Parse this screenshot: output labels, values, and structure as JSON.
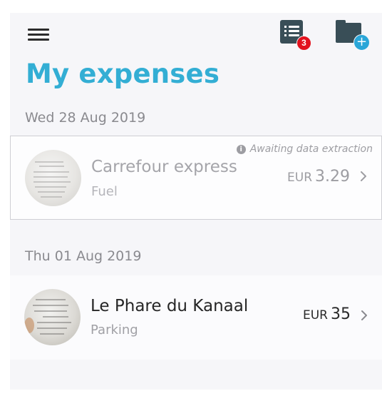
{
  "header": {
    "title": "My expenses",
    "pending_count": "3"
  },
  "groups": [
    {
      "date": "Wed 28 Aug 2019",
      "expense": {
        "status": "Awaiting data extraction",
        "merchant": "Carrefour express",
        "category": "Fuel",
        "currency": "EUR",
        "amount": "3.29"
      }
    },
    {
      "date": "Thu 01 Aug 2019",
      "expense": {
        "merchant": "Le Phare du Kanaal",
        "category": "Parking",
        "currency": "EUR",
        "amount": "35"
      }
    }
  ],
  "icons": {
    "menu": "hamburger-menu-icon",
    "list": "receipt-list-icon",
    "add_folder": "folder-add-icon",
    "info": "info-icon",
    "chevron": "chevron-right-icon"
  },
  "colors": {
    "accent": "#33aed4",
    "badge": "#e2121e",
    "icon_dark": "#394e57",
    "add_blue": "#2aa6d8"
  }
}
